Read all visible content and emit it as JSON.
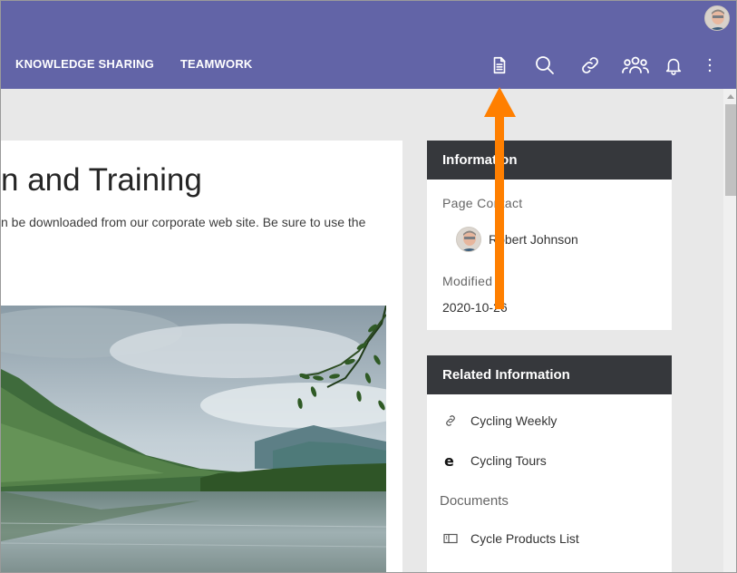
{
  "header": {
    "nav": [
      "KNOWLEDGE SHARING",
      "TEAMWORK"
    ],
    "icons": [
      "page-details-icon",
      "search-icon",
      "link-icon",
      "people-icon",
      "bell-icon",
      "more-vertical-icon"
    ],
    "color": "#6264a7"
  },
  "main": {
    "title": "n and Training",
    "text": "n be downloaded from our corporate web site. Be sure to use the"
  },
  "information": {
    "heading": "Information",
    "contact_label": "Page Contact",
    "contact_name": "Robert Johnson",
    "modified_label": "Modified",
    "modified_date": "2020-10-26"
  },
  "related": {
    "heading": "Related Information",
    "links": [
      {
        "label": "Cycling Weekly",
        "icon": "link-icon"
      },
      {
        "label": "Cycling Tours",
        "icon": "edge-browser-icon"
      }
    ],
    "documents_label": "Documents",
    "documents": [
      {
        "label": "Cycle Products List",
        "icon": "document-list-icon"
      }
    ]
  },
  "annotation": {
    "color": "#ff7f00"
  }
}
